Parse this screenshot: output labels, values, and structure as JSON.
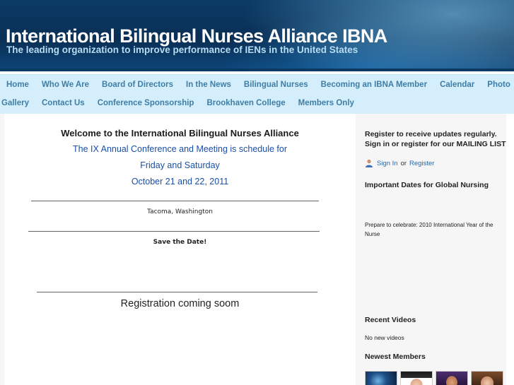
{
  "header": {
    "title": "International Bilingual Nurses Alliance IBNA",
    "tagline": "The leading organization to improve performance of IENs in the United States"
  },
  "nav": {
    "row1": [
      "Home",
      "Who We Are",
      "Board of Directors",
      "In the News",
      "Bilingual Nurses",
      "Becoming an IBNA Member",
      "Calendar",
      "Photo"
    ],
    "row2": [
      "Gallery",
      "Contact Us",
      "Conference Sponsorship",
      "Brookhaven College",
      "Members Only"
    ]
  },
  "main": {
    "welcome": "Welcome to the International Bilingual Nurses Alliance",
    "line1": "The IX Annual Conference and Meeting is schedule for",
    "line2": "Friday and Saturday",
    "line3": "October 21 and 22, 2011",
    "location": "Tacoma, Washington",
    "save_date": "Save the Date!",
    "registration": "Registration coming soom"
  },
  "sidebar": {
    "register_text": "Register to receive updates regularly. Sign in or register for our MAILING LIST",
    "sign_in": "Sign In",
    "or": "or",
    "register": "Register",
    "dates_heading": "Important Dates for Global Nursing",
    "celebrate": "Prepare to celebrate: 2010 International Year of the Nurse",
    "videos_heading": "Recent Videos",
    "no_videos": "No new videos",
    "members_heading": "Newest Members"
  },
  "colors": {
    "header_bg": "#0b3b66",
    "nav_bg": "#d4eefb",
    "nav_text": "#3f7ea6",
    "accent_blue": "#1a4fa8",
    "link": "#2a66a8"
  }
}
